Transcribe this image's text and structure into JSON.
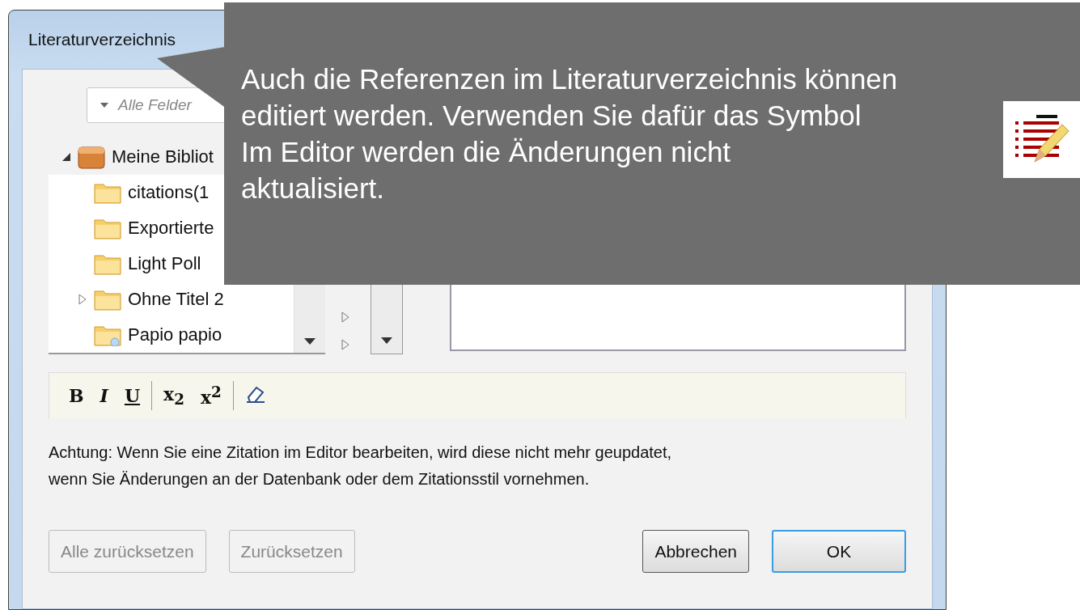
{
  "window": {
    "title": "Literaturverzeichnis"
  },
  "search": {
    "placeholder": "Alle Felder"
  },
  "tree": {
    "label": "Meine Bibliot",
    "expanded": true,
    "children": [
      {
        "label": "citations(1",
        "kind": "folder"
      },
      {
        "label": "Exportierte",
        "kind": "folder"
      },
      {
        "label": "Light Poll",
        "kind": "folder"
      },
      {
        "label": "Ohne Titel 2",
        "kind": "folder",
        "expanded": false
      },
      {
        "label": "Papio papio",
        "kind": "search"
      }
    ]
  },
  "toolbar": [
    {
      "label": "B",
      "kind": "bold"
    },
    {
      "label": "I",
      "kind": "italic"
    },
    {
      "label": "U",
      "kind": "underline"
    },
    {
      "kind": "separator"
    },
    {
      "label": "x$_{2}$",
      "kind": "sub"
    },
    {
      "label": "x$^{2}$",
      "kind": "sup"
    },
    {
      "kind": "separator"
    },
    {
      "kind": "eraser"
    }
  ],
  "warning": "Achtung: Wenn Sie eine Zitation im Editor bearbeiten, wird diese nicht mehr geupdatet,\nwenn Sie Änderungen an der Datenbank oder dem Zitationsstil vornehmen.",
  "buttons": [
    {
      "label": "Alle zurücksetzen",
      "disabled": true,
      "default": false
    },
    {
      "label": "Zurücksetzen",
      "disabled": true,
      "default": false
    },
    {
      "label": "Abbrechen",
      "disabled": false,
      "default": false
    },
    {
      "label": "OK",
      "disabled": false,
      "default": true
    }
  ],
  "callout": {
    "text": "Auch die Referenzen im Literaturverzeichnis können\neditiert werden. Verwenden Sie dafür das Symbol\nIm Editor werden die Änderungen nicht\naktualisiert."
  }
}
